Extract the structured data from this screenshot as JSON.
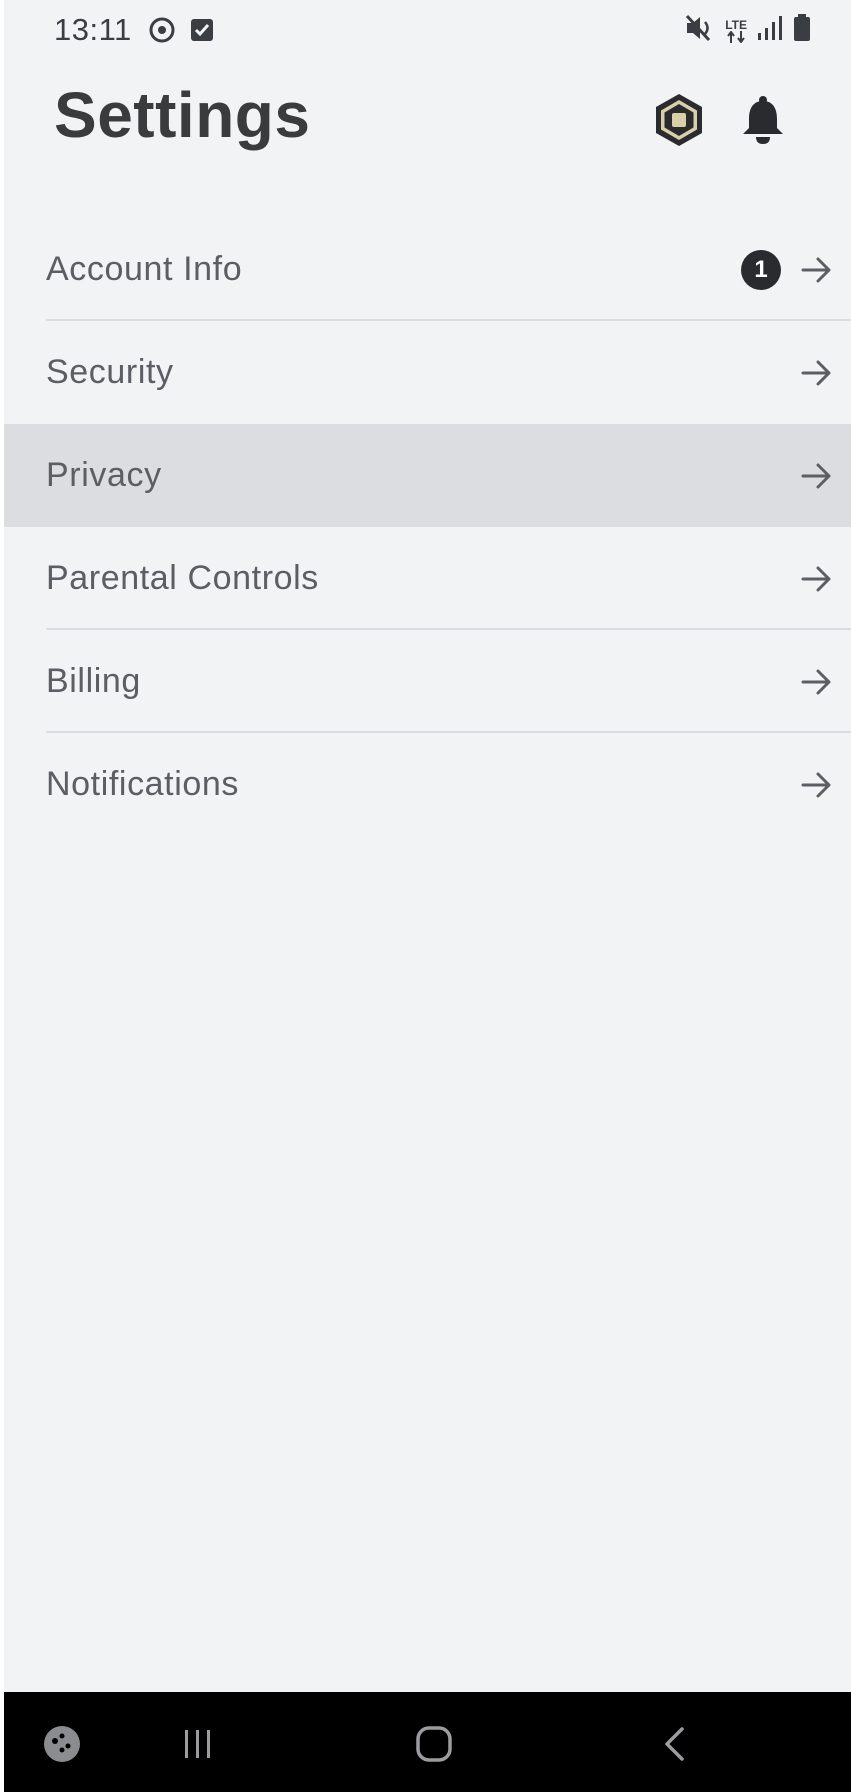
{
  "status_bar": {
    "time": "13:11",
    "left_icons": [
      "sync-icon",
      "checkbox-icon"
    ],
    "right_icons": [
      "mute-icon",
      "lte-icon",
      "signal-icon",
      "battery-icon"
    ],
    "network_label": "LTE"
  },
  "header": {
    "title": "Settings",
    "icons": [
      "robux-icon",
      "bell-icon"
    ]
  },
  "menu": {
    "items": [
      {
        "label": "Account Info",
        "badge": "1"
      },
      {
        "label": "Security"
      },
      {
        "label": "Privacy",
        "selected": true
      },
      {
        "label": "Parental Controls"
      },
      {
        "label": "Billing"
      },
      {
        "label": "Notifications"
      }
    ]
  },
  "nav_bar": {
    "buttons": [
      "game-launcher-icon",
      "recents-icon",
      "home-icon",
      "back-icon"
    ]
  },
  "colors": {
    "background": "#f2f3f5",
    "selected_row": "#dcdde0",
    "title_text": "#393b3d",
    "item_text": "#5b5e63",
    "badge": "#2a2b2e",
    "nav_bar": "#000000"
  }
}
